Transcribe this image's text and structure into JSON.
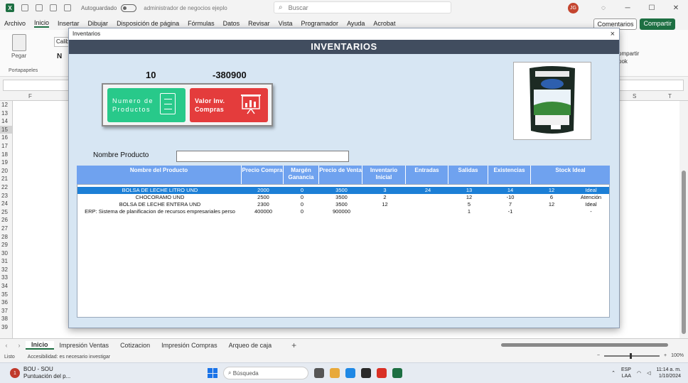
{
  "excel": {
    "autosave_label": "Autoguardado",
    "doc_title": "administrador de negocios ejeplo",
    "search_placeholder": "Buscar",
    "avatar_initials": "JG",
    "menu": [
      "Archivo",
      "Inicio",
      "Insertar",
      "Dibujar",
      "Disposición de página",
      "Fórmulas",
      "Datos",
      "Revisar",
      "Vista",
      "Programador",
      "Ayuda",
      "Acrobat"
    ],
    "comments_label": "Comentarios",
    "share_label": "Compartir",
    "paste_label": "Pegar",
    "font_box": "Calibri",
    "bold_label": "N",
    "clipboard_group": "Portapapeles",
    "ribbon_right_line1": "ompartir",
    "ribbon_right_line2": "ook",
    "col_f": "F",
    "col_s": "S",
    "col_t": "T",
    "rows": [
      "12",
      "13",
      "14",
      "15",
      "16",
      "17",
      "18",
      "19",
      "20",
      "21",
      "22",
      "23",
      "24",
      "25",
      "26",
      "27",
      "28",
      "29",
      "30",
      "31",
      "32",
      "33",
      "34",
      "35",
      "36",
      "37",
      "38",
      "39"
    ],
    "selected_row": "15",
    "sheet_tabs": [
      "Inicio",
      "Impresión Ventas",
      "Cotizacion",
      "Impresión Compras",
      "Arqueo de caja"
    ],
    "status_ready": "Listo",
    "status_accessibility": "Accesibilidad: es necesario investigar",
    "zoom_level": "100%"
  },
  "taskbar": {
    "notification_badge": "1",
    "app_line1": "BOU - SOU",
    "app_line2": "Puntuación del p...",
    "search_placeholder": "Búsqueda",
    "lang_line1": "ESP",
    "lang_line2": "LAA",
    "time": "11:14 a. m.",
    "date": "1/10/2024"
  },
  "dialog": {
    "window_title": "Inventarios",
    "close_glyph": "×",
    "banner": "INVENTARIOS",
    "product_count": "10",
    "inventory_value": "-380900",
    "card_products_line1": "Numero de",
    "card_products_line2": "Productos",
    "card_value_line1": "Valor Inv.",
    "card_value_line2": "Compras",
    "name_label": "Nombre Producto",
    "name_value": "",
    "columns": [
      "Nombre del Producto",
      "Precio Compra",
      "Margén Ganancia",
      "Precio de Venta",
      "Inventario Inicial",
      "Entradas",
      "Salidas",
      "Existencias",
      "Stock Ideal"
    ],
    "rows": [
      [
        "BOLSA DE LECHE LITRO UND",
        "2000",
        "0",
        "3500",
        "3",
        "24",
        "13",
        "14",
        "12",
        "Ideal"
      ],
      [
        "CHOCORAMO UND",
        "2500",
        "0",
        "3500",
        "2",
        "",
        "12",
        "-10",
        "6",
        "Atención"
      ],
      [
        "BOLSA DE LECHE ENTERA UND",
        "2300",
        "0",
        "3500",
        "12",
        "",
        "5",
        "7",
        "12",
        "Ideal"
      ],
      [
        "ERP: Sistema de planificacion de recursos empresariales perso",
        "400000",
        "0",
        "900000",
        "",
        "",
        "1",
        "-1",
        "",
        "-"
      ]
    ],
    "selected_row_index": 0
  },
  "colors": {
    "excel_green": "#1d6f42",
    "banner_bg": "#414d5f",
    "card_green": "#28c98a",
    "card_red": "#e43c3c",
    "table_header": "#6fa2ef",
    "row_selected": "#1c7fd6",
    "dialog_bg": "#d7e6f3"
  }
}
